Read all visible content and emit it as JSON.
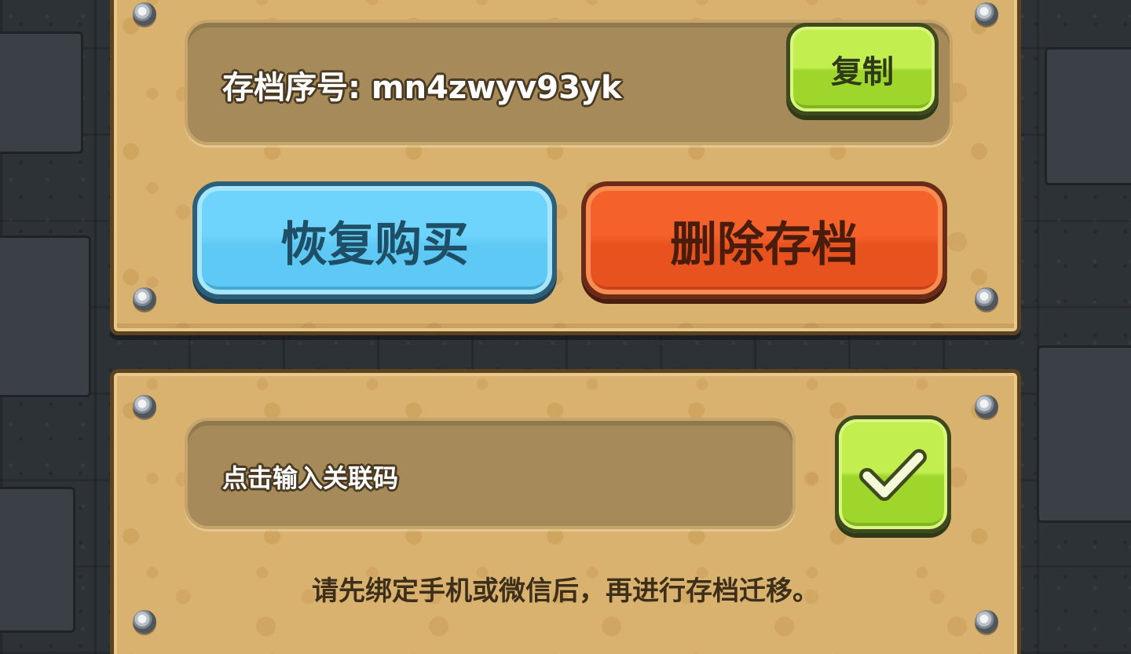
{
  "save_panel": {
    "save_id_label": "存档序号: mn4zwyv93yk",
    "copy_button": "复制",
    "restore_purchase_button": "恢复购买",
    "delete_save_button": "删除存档"
  },
  "migrate_panel": {
    "link_code_placeholder": "点击输入关联码",
    "confirm_icon": "checkmark-icon",
    "hint": "请先绑定手机或微信后，再进行存档迁移。"
  },
  "colors": {
    "panel": "#d9b26f",
    "green_button": "#9ed62c",
    "blue_button": "#5ec9f4",
    "red_button": "#e8521e"
  }
}
